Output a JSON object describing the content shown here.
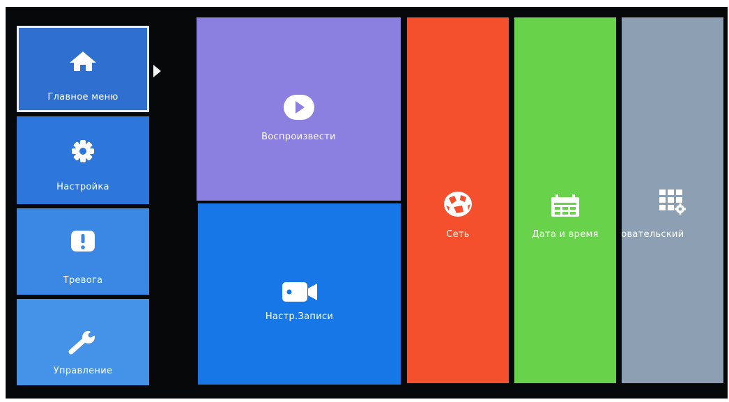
{
  "sidebar": {
    "items": [
      {
        "label": "Главное меню",
        "icon": "home-icon",
        "color": "#2e6fcf",
        "selected": true
      },
      {
        "label": "Настройка",
        "icon": "gear-icon",
        "color": "#2d76dc"
      },
      {
        "label": "Тревога",
        "icon": "alert-icon",
        "color": "#3a87e4"
      },
      {
        "label": "Управление",
        "icon": "wrench-icon",
        "color": "#4593e8"
      }
    ]
  },
  "tiles": {
    "playback": {
      "label": "Воспроизвести",
      "icon": "play-icon",
      "color": "#8b7fe0"
    },
    "record": {
      "label": "Настр.Записи",
      "icon": "camera-icon",
      "color": "#1877e6"
    },
    "network": {
      "label": "Сеть",
      "icon": "globe-icon",
      "color": "#f4502d"
    },
    "datetime": {
      "label": "Дата и время",
      "icon": "calendar-icon",
      "color": "#68d34a"
    },
    "user": {
      "label": "зовательский",
      "icon": "grid-gear-icon",
      "color": "#8d9fb2"
    }
  }
}
